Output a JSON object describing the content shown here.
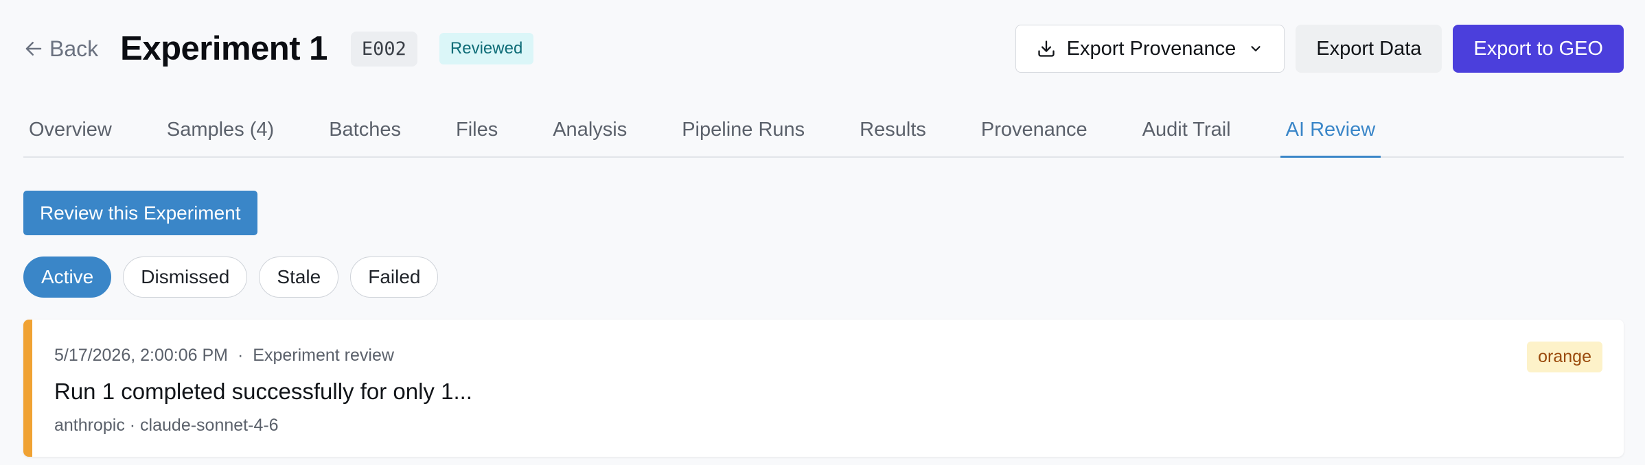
{
  "header": {
    "back_label": "Back",
    "title": "Experiment 1",
    "experiment_id": "E002",
    "status": "Reviewed",
    "actions": {
      "export_provenance": "Export Provenance",
      "export_data": "Export Data",
      "export_geo": "Export to GEO"
    }
  },
  "tabs": [
    {
      "label": "Overview"
    },
    {
      "label": "Samples (4)"
    },
    {
      "label": "Batches"
    },
    {
      "label": "Files"
    },
    {
      "label": "Analysis"
    },
    {
      "label": "Pipeline Runs"
    },
    {
      "label": "Results"
    },
    {
      "label": "Provenance"
    },
    {
      "label": "Audit Trail"
    },
    {
      "label": "AI Review"
    }
  ],
  "active_tab": "AI Review",
  "review": {
    "button_label": "Review this Experiment",
    "filters": [
      {
        "label": "Active"
      },
      {
        "label": "Dismissed"
      },
      {
        "label": "Stale"
      },
      {
        "label": "Failed"
      }
    ],
    "active_filter": "Active",
    "items": [
      {
        "timestamp": "5/17/2026, 2:00:06 PM",
        "separator": "·",
        "type": "Experiment review",
        "title": "Run 1 completed successfully for only 1...",
        "model": "anthropic · claude-sonnet-4-6",
        "severity": "orange"
      }
    ]
  },
  "colors": {
    "accent_blue": "#3a86c8",
    "primary_purple": "#4b3fdc",
    "severity_orange": "#f0a233",
    "status_teal": "#0e6c77"
  }
}
